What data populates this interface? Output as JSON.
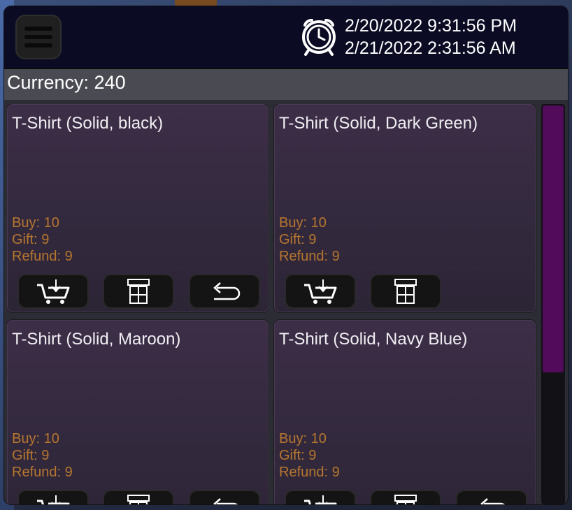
{
  "header": {
    "menu_icon": "hamburger-menu-icon",
    "clock_icon": "alarm-clock-icon",
    "datetime_line1": "2/20/2022 9:31:56 PM",
    "datetime_line2": "2/21/2022 2:31:56 AM"
  },
  "currency": {
    "label": "Currency: 240"
  },
  "cards": [
    {
      "title": "T-Shirt (Solid, black)",
      "buy": "Buy: 10",
      "gift": "Gift: 9",
      "refund": "Refund: 9",
      "buttons": [
        "cart-buy-icon",
        "gift-box-icon",
        "refund-return-icon"
      ]
    },
    {
      "title": "T-Shirt (Solid, Dark Green)",
      "buy": "Buy: 10",
      "gift": "Gift: 9",
      "refund": "Refund: 9",
      "buttons": [
        "cart-buy-icon",
        "gift-box-icon"
      ]
    },
    {
      "title": "T-Shirt (Solid, Maroon)",
      "buy": "Buy: 10",
      "gift": "Gift: 9",
      "refund": "Refund: 9",
      "buttons": [
        "cart-buy-icon",
        "gift-box-icon",
        "refund-return-icon"
      ]
    },
    {
      "title": "T-Shirt (Solid, Navy Blue)",
      "buy": "Buy: 10",
      "gift": "Gift: 9",
      "refund": "Refund: 9",
      "buttons": [
        "cart-buy-icon",
        "gift-box-icon",
        "refund-return-icon"
      ]
    }
  ],
  "colors": {
    "topbar": "#0b0b24",
    "card": "#3c2e47",
    "stat_text": "#b8762e",
    "scroll_thumb": "#520a5a"
  },
  "scroll": {
    "thumb_fraction": 0.67
  }
}
